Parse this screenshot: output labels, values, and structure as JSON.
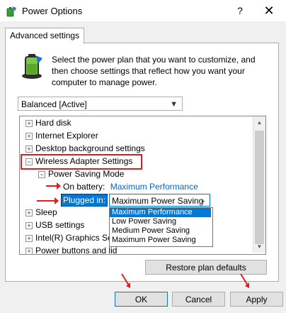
{
  "window": {
    "title": "Power Options",
    "help_glyph": "?",
    "close_glyph": "✕"
  },
  "tab": {
    "label": "Advanced settings"
  },
  "intro": {
    "line1": "Select the power plan that you want to customize, and",
    "line2": "then choose settings that reflect how you want your",
    "line3": "computer to manage power."
  },
  "plan_select": {
    "value": "Balanced [Active]"
  },
  "tree": {
    "items": [
      {
        "label": "Hard disk",
        "expander": "+"
      },
      {
        "label": "Internet Explorer",
        "expander": "+"
      },
      {
        "label": "Desktop background settings",
        "expander": "+"
      },
      {
        "label": "Wireless Adapter Settings",
        "expander": "−"
      },
      {
        "label": "Power Saving Mode",
        "expander": "−"
      },
      {
        "label": "On battery:",
        "value": "Maximum Performance"
      },
      {
        "label": "Plugged in:",
        "value": "Maximum Power Saving"
      },
      {
        "label": "Sleep",
        "expander": "+"
      },
      {
        "label": "USB settings",
        "expander": "+"
      },
      {
        "label": "Intel(R) Graphics Se",
        "expander": "+"
      },
      {
        "label": "Power buttons and lid",
        "expander": "+"
      }
    ]
  },
  "dropdown": {
    "options": [
      "Maximum Performance",
      "Low Power Saving",
      "Medium Power Saving",
      "Maximum Power Saving"
    ],
    "highlighted_index": 0
  },
  "buttons": {
    "restore": "Restore plan defaults",
    "ok": "OK",
    "cancel": "Cancel",
    "apply": "Apply"
  },
  "colors": {
    "annotation_red": "#e21d1d",
    "selection_blue": "#0078d7",
    "link_blue": "#0066cc"
  }
}
